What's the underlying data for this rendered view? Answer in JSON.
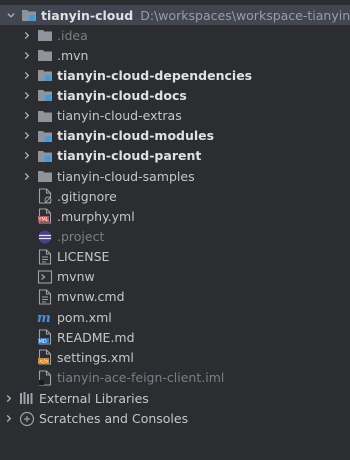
{
  "project": {
    "name": "tianyin-cloud",
    "path": "D:\\workspaces\\workspace-tianyin-bas"
  },
  "folders": [
    {
      "label": ".idea",
      "style": "dim",
      "module": false
    },
    {
      "label": ".mvn",
      "style": "normal",
      "module": false
    },
    {
      "label": "tianyin-cloud-dependencies",
      "style": "bold",
      "module": true
    },
    {
      "label": "tianyin-cloud-docs",
      "style": "bold",
      "module": true
    },
    {
      "label": "tianyin-cloud-extras",
      "style": "normal",
      "module": false
    },
    {
      "label": "tianyin-cloud-modules",
      "style": "bold",
      "module": true
    },
    {
      "label": "tianyin-cloud-parent",
      "style": "bold",
      "module": true
    },
    {
      "label": "tianyin-cloud-samples",
      "style": "normal",
      "module": false
    }
  ],
  "files": [
    {
      "label": ".gitignore",
      "icon": "gitignore-file-icon",
      "style": "normal"
    },
    {
      "label": ".murphy.yml",
      "icon": "yaml-file-icon",
      "style": "normal"
    },
    {
      "label": ".project",
      "icon": "eclipse-project-file-icon",
      "style": "dim"
    },
    {
      "label": "LICENSE",
      "icon": "text-file-icon",
      "style": "normal"
    },
    {
      "label": "mvnw",
      "icon": "shell-script-icon",
      "style": "normal"
    },
    {
      "label": "mvnw.cmd",
      "icon": "text-file-icon",
      "style": "normal"
    },
    {
      "label": "pom.xml",
      "icon": "maven-pom-icon",
      "style": "normal"
    },
    {
      "label": "README.md",
      "icon": "markdown-file-icon",
      "style": "normal"
    },
    {
      "label": "settings.xml",
      "icon": "xml-file-icon",
      "style": "normal"
    },
    {
      "label": "tianyin-ace-feign-client.iml",
      "icon": "iml-file-icon",
      "style": "dim"
    }
  ],
  "bottom": [
    {
      "label": "External Libraries",
      "icon": "external-libraries-icon"
    },
    {
      "label": "Scratches and Consoles",
      "icon": "scratches-consoles-icon"
    }
  ],
  "colors": {
    "background": "#2b2d30",
    "selection": "#414650",
    "folder": "#8f949c",
    "module_badge": "#3d9de0"
  }
}
